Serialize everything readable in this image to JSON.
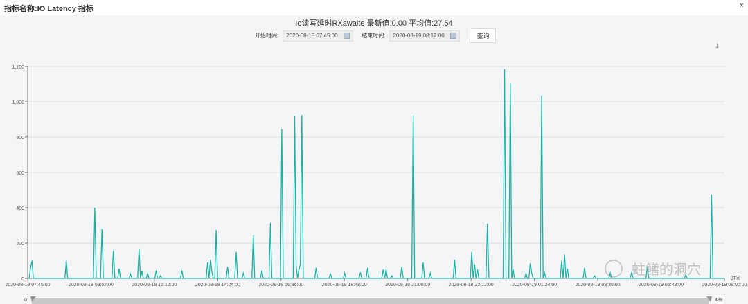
{
  "window": {
    "title": "指标名称:IO Latency 指标",
    "close": "×"
  },
  "chart_title": "Io读写延时RXawaite 最新值:0.00 平均值:27.54",
  "form": {
    "start_label": "开始时间:",
    "start_value": "2020-08-18 07:45:00",
    "end_label": "结束时间:",
    "end_value": "2020-08-19 08:12:00",
    "query": "查询"
  },
  "download_icon": "download-icon",
  "slider": {
    "min": "0",
    "max": "488",
    "start": 0,
    "end": 488
  },
  "watermark": "蛀鳝的洞穴",
  "colors": {
    "line": "#1bb2a6",
    "grid": "#dddddd"
  },
  "chart_data": {
    "type": "line",
    "xlabel": "时间",
    "ylim": [
      0,
      1200
    ],
    "yticks": [
      "0",
      "200",
      "400",
      "600",
      "800",
      "1,000",
      "1,200"
    ],
    "ytick_values": [
      0,
      200,
      400,
      600,
      800,
      1000,
      1200
    ],
    "xticks": [
      "2020-08-18 07:45:00",
      "2020-08-18 09:57:00",
      "2020-08-18 12:12:00",
      "2020-08-18 14:24:00",
      "2020-08-18 16:36:00",
      "2020-08-18 18:48:00",
      "2020-08-18 21:00:00",
      "2020-08-18 23:12:00",
      "2020-08-19 01:24:00",
      "2020-08-19 03:36:00",
      "2020-08-19 05:48:00",
      "2020-08-19 08:00:00"
    ],
    "point_count": 489,
    "baseline": 0,
    "spikes": [
      [
        2,
        60
      ],
      [
        3,
        100
      ],
      [
        27,
        100
      ],
      [
        47,
        400
      ],
      [
        52,
        280
      ],
      [
        60,
        155
      ],
      [
        64,
        55
      ],
      [
        72,
        25
      ],
      [
        78,
        165
      ],
      [
        80,
        40
      ],
      [
        84,
        30
      ],
      [
        90,
        45
      ],
      [
        93,
        15
      ],
      [
        108,
        45
      ],
      [
        126,
        90
      ],
      [
        128,
        105
      ],
      [
        129,
        40
      ],
      [
        132,
        275
      ],
      [
        140,
        65
      ],
      [
        146,
        150
      ],
      [
        151,
        30
      ],
      [
        158,
        245
      ],
      [
        164,
        45
      ],
      [
        170,
        315
      ],
      [
        178,
        845
      ],
      [
        187,
        920
      ],
      [
        188,
        70
      ],
      [
        190,
        50
      ],
      [
        191,
        80
      ],
      [
        192,
        925
      ],
      [
        202,
        60
      ],
      [
        212,
        25
      ],
      [
        222,
        30
      ],
      [
        233,
        35
      ],
      [
        238,
        60
      ],
      [
        249,
        50
      ],
      [
        251,
        50
      ],
      [
        255,
        15
      ],
      [
        262,
        65
      ],
      [
        270,
        920
      ],
      [
        277,
        90
      ],
      [
        282,
        30
      ],
      [
        299,
        105
      ],
      [
        311,
        150
      ],
      [
        313,
        80
      ],
      [
        315,
        50
      ],
      [
        322,
        310
      ],
      [
        334,
        1185
      ],
      [
        338,
        1105
      ],
      [
        340,
        50
      ],
      [
        349,
        30
      ],
      [
        352,
        85
      ],
      [
        353,
        30
      ],
      [
        360,
        1035
      ],
      [
        362,
        30
      ],
      [
        374,
        100
      ],
      [
        376,
        135
      ],
      [
        378,
        55
      ],
      [
        390,
        60
      ],
      [
        397,
        15
      ],
      [
        408,
        30
      ],
      [
        423,
        35
      ],
      [
        434,
        65
      ],
      [
        461,
        20
      ],
      [
        479,
        475
      ]
    ]
  }
}
